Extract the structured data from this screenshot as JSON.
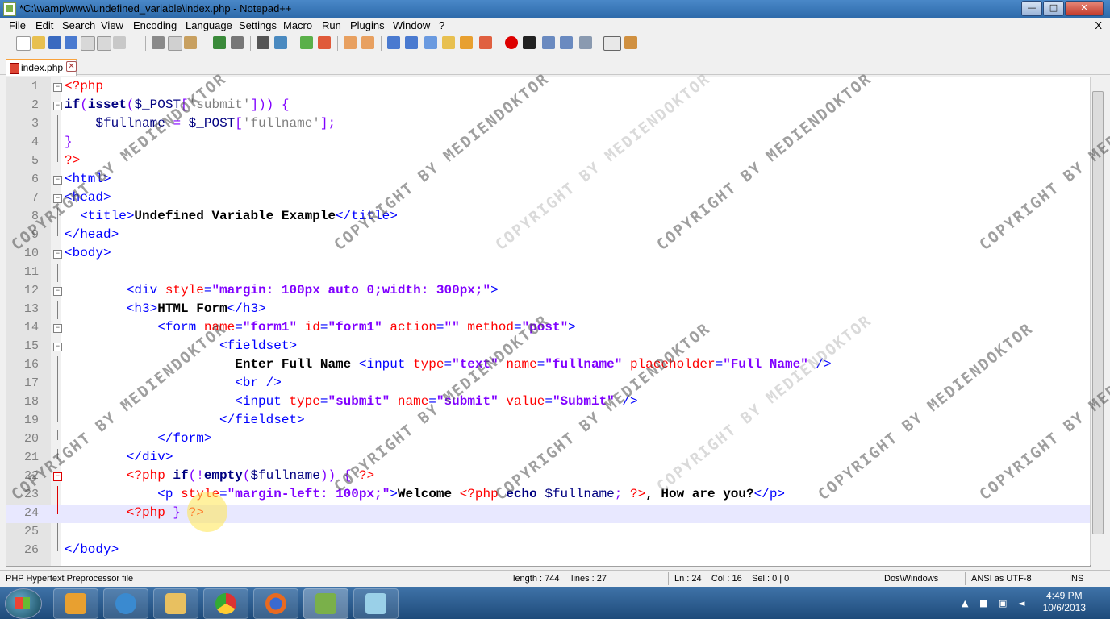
{
  "window": {
    "title": "*C:\\wamp\\www\\undefined_variable\\index.php - Notepad++",
    "controls": {
      "minimize": "—",
      "maximize": "□",
      "close": "✕"
    }
  },
  "menu": {
    "items": [
      "File",
      "Edit",
      "Search",
      "View",
      "Encoding",
      "Language",
      "Settings",
      "Macro",
      "Run",
      "Plugins",
      "Window",
      "?"
    ],
    "close_doc": "X"
  },
  "tabs": [
    {
      "label": "index.php",
      "close": "✕"
    }
  ],
  "editor": {
    "current_line": 24,
    "lines": [
      {
        "n": "1",
        "fold": "box",
        "segs": [
          [
            "php",
            "<?php"
          ]
        ]
      },
      {
        "n": "2",
        "fold": "box",
        "segs": [
          [
            "kw",
            "if"
          ],
          [
            "op",
            "("
          ],
          [
            "kw",
            "isset"
          ],
          [
            "op",
            "("
          ],
          [
            "var",
            "$_POST"
          ],
          [
            "op",
            "["
          ],
          [
            "phpstr",
            "'submit'"
          ],
          [
            "op",
            "]))"
          ],
          [
            "plain",
            " "
          ],
          [
            "op",
            "{"
          ]
        ]
      },
      {
        "n": "3",
        "fold": "line",
        "segs": [
          [
            "plain",
            "    "
          ],
          [
            "var",
            "$fullname"
          ],
          [
            "plain",
            " "
          ],
          [
            "op",
            "="
          ],
          [
            "plain",
            " "
          ],
          [
            "var",
            "$_POST"
          ],
          [
            "op",
            "["
          ],
          [
            "phpstr",
            "'fullname'"
          ],
          [
            "op",
            "];"
          ]
        ]
      },
      {
        "n": "4",
        "fold": "line",
        "segs": [
          [
            "op",
            "}"
          ]
        ]
      },
      {
        "n": "5",
        "fold": "end",
        "segs": [
          [
            "php",
            "?>"
          ]
        ]
      },
      {
        "n": "6",
        "fold": "box",
        "segs": [
          [
            "tag",
            "<html>"
          ]
        ]
      },
      {
        "n": "7",
        "fold": "box",
        "segs": [
          [
            "tag",
            "<head>"
          ]
        ]
      },
      {
        "n": "8",
        "fold": "line",
        "segs": [
          [
            "plain",
            "  "
          ],
          [
            "tag",
            "<title>"
          ],
          [
            "bold",
            "Undefined Variable Example"
          ],
          [
            "tag",
            "</title>"
          ]
        ]
      },
      {
        "n": "9",
        "fold": "end",
        "segs": [
          [
            "tag",
            "</head>"
          ]
        ]
      },
      {
        "n": "10",
        "fold": "box",
        "segs": [
          [
            "tag",
            "<body>"
          ]
        ]
      },
      {
        "n": "11",
        "fold": "line",
        "segs": []
      },
      {
        "n": "12",
        "fold": "box",
        "segs": [
          [
            "plain",
            "        "
          ],
          [
            "tag",
            "<div "
          ],
          [
            "attr",
            "style"
          ],
          [
            "tag",
            "="
          ],
          [
            "str",
            "\"margin: 100px auto 0;width: 300px;\""
          ],
          [
            "tag",
            ">"
          ]
        ]
      },
      {
        "n": "13",
        "fold": "line",
        "segs": [
          [
            "plain",
            "        "
          ],
          [
            "tag",
            "<h3>"
          ],
          [
            "bold",
            "HTML Form"
          ],
          [
            "tag",
            "</h3>"
          ]
        ]
      },
      {
        "n": "14",
        "fold": "box",
        "segs": [
          [
            "plain",
            "            "
          ],
          [
            "tag",
            "<form "
          ],
          [
            "attr",
            "name"
          ],
          [
            "tag",
            "="
          ],
          [
            "str",
            "\"form1\""
          ],
          [
            "plain",
            " "
          ],
          [
            "attr",
            "id"
          ],
          [
            "tag",
            "="
          ],
          [
            "str",
            "\"form1\""
          ],
          [
            "plain",
            " "
          ],
          [
            "attr",
            "action"
          ],
          [
            "tag",
            "="
          ],
          [
            "str",
            "\"\""
          ],
          [
            "plain",
            " "
          ],
          [
            "attr",
            "method"
          ],
          [
            "tag",
            "="
          ],
          [
            "str",
            "\"post\""
          ],
          [
            "tag",
            ">"
          ]
        ]
      },
      {
        "n": "15",
        "fold": "box",
        "segs": [
          [
            "plain",
            "                    "
          ],
          [
            "tag",
            "<fieldset>"
          ]
        ]
      },
      {
        "n": "16",
        "fold": "line",
        "segs": [
          [
            "plain",
            "                      "
          ],
          [
            "bold",
            "Enter Full Name "
          ],
          [
            "tag",
            "<input "
          ],
          [
            "attr",
            "type"
          ],
          [
            "tag",
            "="
          ],
          [
            "str",
            "\"text\""
          ],
          [
            "plain",
            " "
          ],
          [
            "attr",
            "name"
          ],
          [
            "tag",
            "="
          ],
          [
            "str",
            "\"fullname\""
          ],
          [
            "plain",
            " "
          ],
          [
            "attr",
            "placeholder"
          ],
          [
            "tag",
            "="
          ],
          [
            "str",
            "\"Full Name\""
          ],
          [
            "plain",
            " "
          ],
          [
            "tag",
            "/>"
          ]
        ]
      },
      {
        "n": "17",
        "fold": "line",
        "segs": [
          [
            "plain",
            "                      "
          ],
          [
            "tag",
            "<br />"
          ]
        ]
      },
      {
        "n": "18",
        "fold": "line",
        "segs": [
          [
            "plain",
            "                      "
          ],
          [
            "tag",
            "<input "
          ],
          [
            "attr",
            "type"
          ],
          [
            "tag",
            "="
          ],
          [
            "str",
            "\"submit\""
          ],
          [
            "plain",
            " "
          ],
          [
            "attr",
            "name"
          ],
          [
            "tag",
            "="
          ],
          [
            "str",
            "\"submit\""
          ],
          [
            "plain",
            " "
          ],
          [
            "attr",
            "value"
          ],
          [
            "tag",
            "="
          ],
          [
            "str",
            "\"Submit\""
          ],
          [
            "plain",
            " "
          ],
          [
            "tag",
            "/>"
          ]
        ]
      },
      {
        "n": "19",
        "fold": "end",
        "segs": [
          [
            "plain",
            "                    "
          ],
          [
            "tag",
            "</fieldset>"
          ]
        ]
      },
      {
        "n": "20",
        "fold": "end",
        "segs": [
          [
            "plain",
            "            "
          ],
          [
            "tag",
            "</form>"
          ]
        ]
      },
      {
        "n": "21",
        "fold": "end",
        "segs": [
          [
            "plain",
            "        "
          ],
          [
            "tag",
            "</div>"
          ]
        ]
      },
      {
        "n": "22",
        "fold": "boxred",
        "segs": [
          [
            "plain",
            "        "
          ],
          [
            "php",
            "<?php "
          ],
          [
            "kw",
            "if"
          ],
          [
            "op",
            "(!"
          ],
          [
            "kw",
            "empty"
          ],
          [
            "op",
            "("
          ],
          [
            "var",
            "$fullname"
          ],
          [
            "op",
            "))"
          ],
          [
            "plain",
            " "
          ],
          [
            "op",
            "{"
          ],
          [
            "plain",
            " "
          ],
          [
            "php",
            "?>"
          ]
        ]
      },
      {
        "n": "23",
        "fold": "linered",
        "segs": [
          [
            "plain",
            "            "
          ],
          [
            "tag",
            "<p "
          ],
          [
            "attr",
            "style"
          ],
          [
            "tag",
            "="
          ],
          [
            "str",
            "\"margin-left: 100px;\""
          ],
          [
            "tag",
            ">"
          ],
          [
            "bold",
            "Welcome "
          ],
          [
            "php",
            "<?php "
          ],
          [
            "kw",
            "echo"
          ],
          [
            "plain",
            " "
          ],
          [
            "var",
            "$fullname"
          ],
          [
            "op",
            ";"
          ],
          [
            "plain",
            " "
          ],
          [
            "php",
            "?>"
          ],
          [
            "bold",
            ", How are you?"
          ],
          [
            "tag",
            "</p>"
          ]
        ]
      },
      {
        "n": "24",
        "fold": "endred",
        "segs": [
          [
            "plain",
            "        "
          ],
          [
            "php",
            "<?php "
          ],
          [
            "op",
            "}"
          ],
          [
            "plain",
            " "
          ],
          [
            "php",
            "?>"
          ]
        ]
      },
      {
        "n": "25",
        "fold": "line",
        "segs": []
      },
      {
        "n": "26",
        "fold": "end",
        "segs": [
          [
            "tag",
            "</body>"
          ]
        ]
      }
    ]
  },
  "status": {
    "file_type": "PHP Hypertext Preprocessor file",
    "length": "length : 744",
    "lines": "lines : 27",
    "cursor": "Ln : 24    Col : 16    Sel : 0 | 0",
    "eol": "Dos\\Windows",
    "encoding": "ANSI as UTF-8",
    "mode": "INS"
  },
  "taskbar": {
    "time": "4:49 PM",
    "date": "10/6/2013"
  },
  "watermark": {
    "text": "COPYRIGHT BY MEDIENDOKTOR"
  }
}
